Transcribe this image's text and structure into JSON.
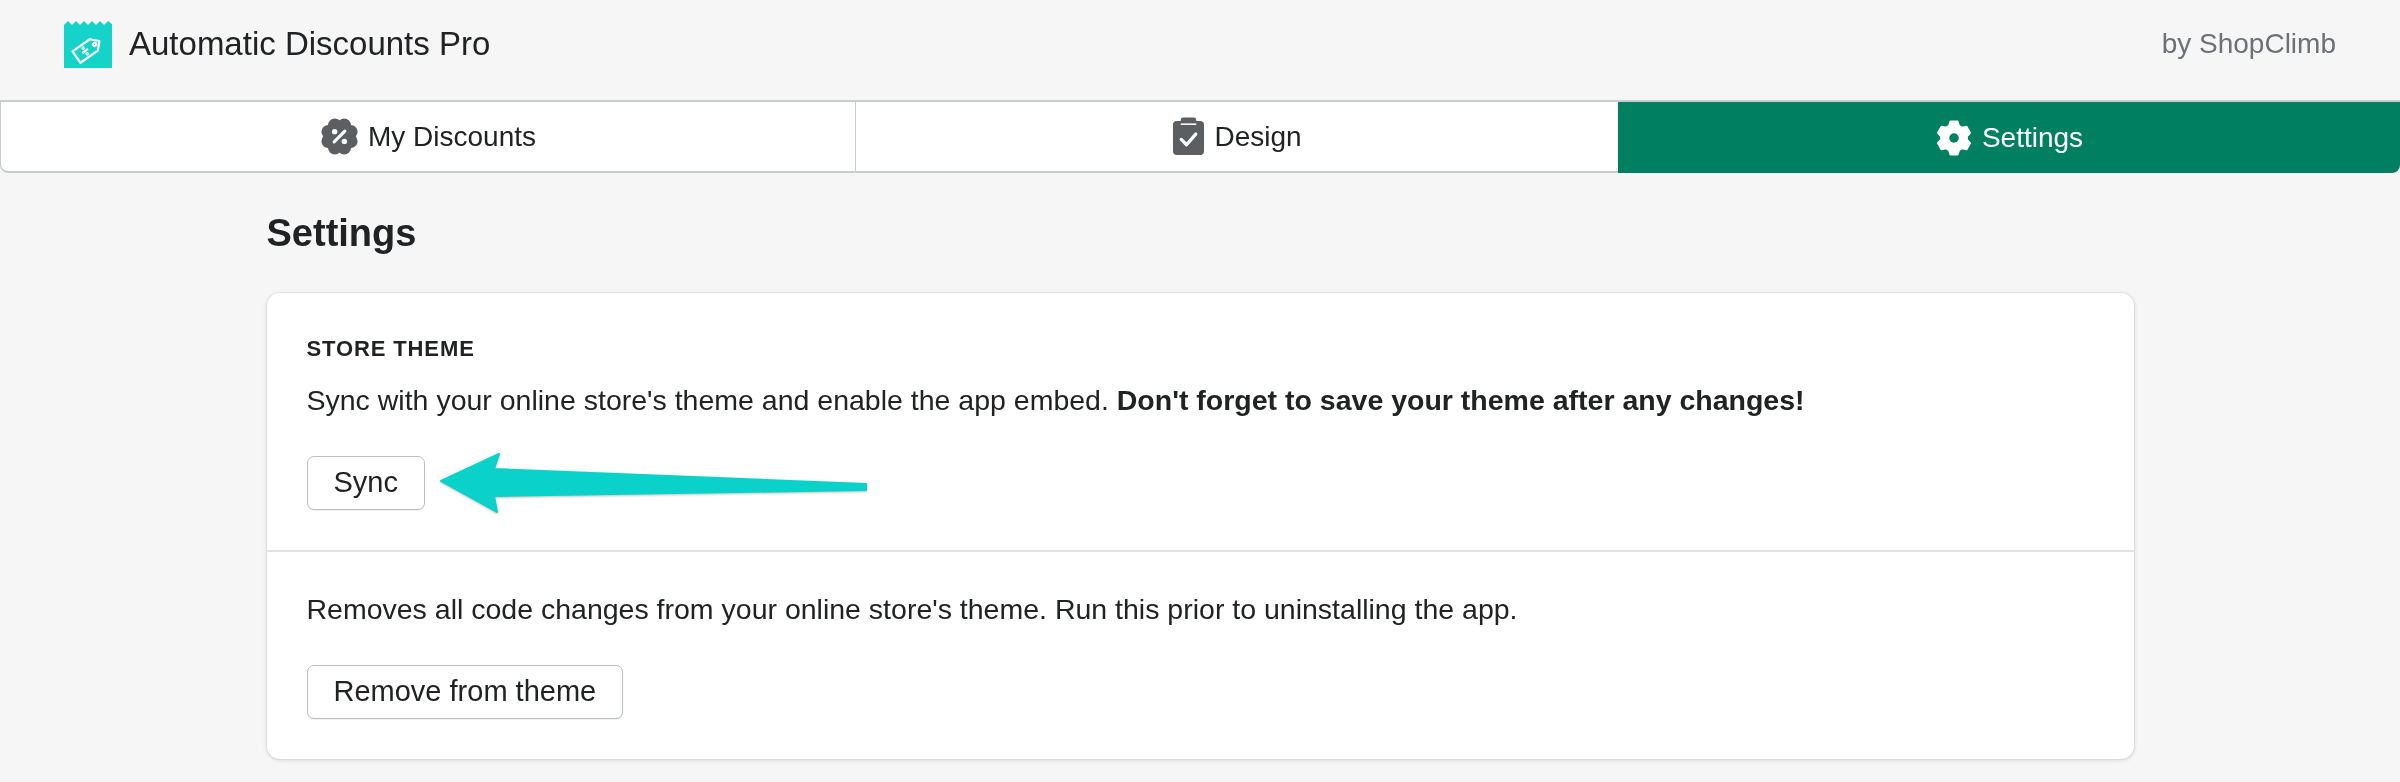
{
  "app": {
    "title": "Automatic Discounts Pro",
    "vendor": "by ShopClimb"
  },
  "tabs": [
    {
      "label": "My Discounts",
      "selected": false
    },
    {
      "label": "Design",
      "selected": false
    },
    {
      "label": "Settings",
      "selected": true
    }
  ],
  "page": {
    "title": "Settings"
  },
  "card": {
    "sections": [
      {
        "heading": "STORE THEME",
        "text": "Sync with your online store's theme and enable the app embed. **Don't forget to save your theme after any changes!**",
        "button": "Sync"
      },
      {
        "text": "Removes all code changes from your online store's theme. Run this prior to uninstalling the app.",
        "button": "Remove from theme"
      }
    ]
  }
}
